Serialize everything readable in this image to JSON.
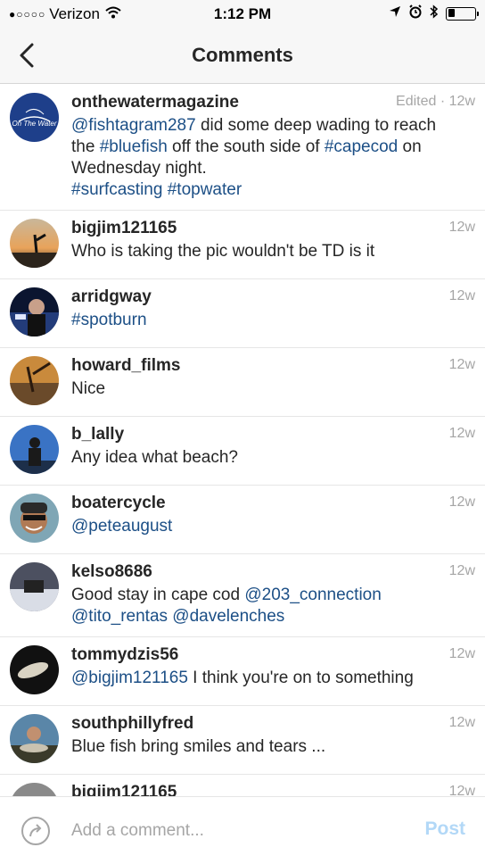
{
  "status": {
    "carrier": "Verizon",
    "time": "1:12 PM",
    "battery_level": 0.25
  },
  "nav": {
    "title": "Comments"
  },
  "comments": [
    {
      "username": "onthewatermagazine",
      "edited": "Edited · ",
      "time": "12w",
      "avatar_text": "On The Water",
      "segments": [
        {
          "t": "@fishtagram287",
          "tag": true
        },
        {
          "t": " did some deep wading to reach the ",
          "tag": false
        },
        {
          "t": "#bluefish",
          "tag": true
        },
        {
          "t": " off the south side of ",
          "tag": false
        },
        {
          "t": "#capecod",
          "tag": true
        },
        {
          "t": " on Wednesday night.",
          "tag": false
        },
        {
          "br": true
        },
        {
          "t": "#surfcasting",
          "tag": true
        },
        {
          "t": " ",
          "tag": false
        },
        {
          "t": "#topwater",
          "tag": true
        }
      ]
    },
    {
      "username": "bigjim121165",
      "time": "12w",
      "segments": [
        {
          "t": "Who is taking the pic wouldn't be TD is it",
          "tag": false
        }
      ]
    },
    {
      "username": "arridgway",
      "time": "12w",
      "segments": [
        {
          "t": "#spotburn",
          "tag": true
        }
      ]
    },
    {
      "username": "howard_films",
      "time": "12w",
      "segments": [
        {
          "t": "Nice",
          "tag": false
        }
      ]
    },
    {
      "username": "b_lally",
      "time": "12w",
      "segments": [
        {
          "t": "Any idea what beach?",
          "tag": false
        }
      ]
    },
    {
      "username": "boatercycle",
      "time": "12w",
      "segments": [
        {
          "t": "@peteaugust",
          "tag": true
        }
      ]
    },
    {
      "username": "kelso8686",
      "time": "12w",
      "segments": [
        {
          "t": "Good stay in cape cod ",
          "tag": false
        },
        {
          "t": "@203_connection",
          "tag": true
        },
        {
          "t": " ",
          "tag": false
        },
        {
          "t": "@tito_rentas",
          "tag": true
        },
        {
          "t": " ",
          "tag": false
        },
        {
          "t": "@davelenches",
          "tag": true
        }
      ]
    },
    {
      "username": "tommydzis56",
      "time": "12w",
      "segments": [
        {
          "t": "@bigjim121165",
          "tag": true
        },
        {
          "t": " I think you're on to something",
          "tag": false
        }
      ]
    },
    {
      "username": "southphillyfred",
      "time": "12w",
      "segments": [
        {
          "t": "Blue fish bring smiles and tears ...",
          "tag": false
        }
      ]
    },
    {
      "username": "bigjim121165",
      "time": "12w",
      "segments": []
    }
  ],
  "composer": {
    "placeholder": "Add a comment...",
    "post_label": "Post"
  },
  "colors": {
    "tag": "#1c4f86",
    "post_disabled": "#b2d8f7",
    "muted": "#a6a6a6"
  }
}
